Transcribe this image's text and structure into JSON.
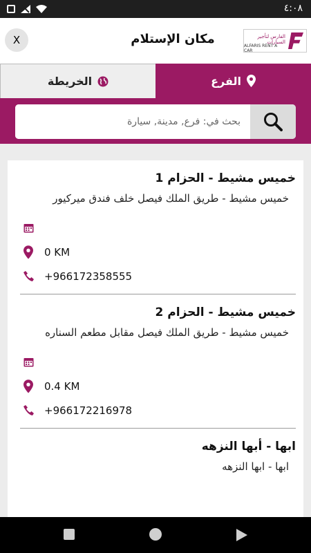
{
  "status_bar": {
    "time": "٤:٠٨"
  },
  "header": {
    "title": "مكان الإستلام",
    "close_label": "X",
    "logo_arabic": "الفارس لتأجير السيارات",
    "logo_english": "ALFARIS RENT A CAR"
  },
  "tabs": {
    "map_label": "الخريطة",
    "branch_label": "الفرع"
  },
  "search": {
    "placeholder": "بحث في: فرع, مدينة, سيارة"
  },
  "branches": [
    {
      "name": "خميس مشيط - الحزام 1",
      "address": "خميس مشيط - طريق الملك فيصل خلف فندق ميركيور",
      "distance": "0 KM",
      "phone": "+966172358555"
    },
    {
      "name": "خميس مشيط - الحزام 2",
      "address": "خميس مشيط - طريق الملك فيصل مقابل مطعم السناره",
      "distance": "0.4 KM",
      "phone": "+966172216978"
    },
    {
      "name": "ابها - أبها النزهه",
      "address": "ابها - ابها النزهه",
      "distance": "",
      "phone": ""
    }
  ],
  "colors": {
    "accent": "#9b1a63"
  }
}
